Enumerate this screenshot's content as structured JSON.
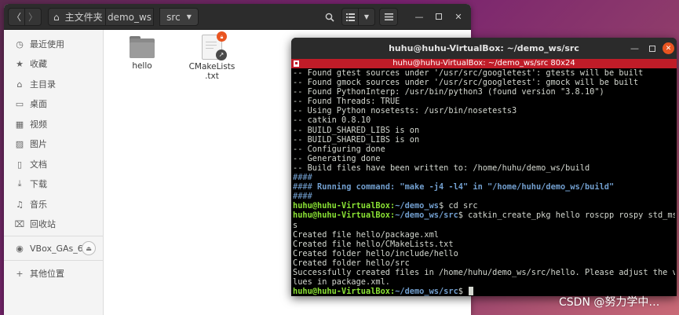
{
  "file_manager": {
    "breadcrumb": {
      "home": "主文件夹",
      "ws": "demo_ws",
      "src": "src"
    },
    "sidebar": [
      {
        "icon": "clock-icon",
        "label": "最近使用"
      },
      {
        "icon": "star-icon",
        "label": "收藏"
      },
      {
        "icon": "home-icon",
        "label": "主目录"
      },
      {
        "icon": "desktop-icon",
        "label": "桌面"
      },
      {
        "icon": "video-icon",
        "label": "视频"
      },
      {
        "icon": "image-icon",
        "label": "图片"
      },
      {
        "icon": "document-icon",
        "label": "文档"
      },
      {
        "icon": "download-icon",
        "label": "下载"
      },
      {
        "icon": "music-icon",
        "label": "音乐"
      },
      {
        "icon": "trash-icon",
        "label": "回收站"
      },
      {
        "icon": "disc-icon",
        "label": "VBox_GAs_6...."
      },
      {
        "icon": "plus-icon",
        "label": "其他位置"
      }
    ],
    "files": [
      {
        "name": "hello",
        "type": "folder"
      },
      {
        "name": "CMakeLists\n.txt",
        "type": "text"
      }
    ]
  },
  "terminal": {
    "title": "huhu@huhu-VirtualBox: ~/demo_ws/src",
    "tab_label": "huhu@huhu-VirtualBox: ~/demo_ws/src 80x24",
    "lines": [
      "-- Found gtest sources under '/usr/src/googletest': gtests will be built",
      "-- Found gmock sources under '/usr/src/googletest': gmock will be built",
      "-- Found PythonInterp: /usr/bin/python3 (found version \"3.8.10\")",
      "-- Found Threads: TRUE",
      "-- Using Python nosetests: /usr/bin/nosetests3",
      "-- catkin 0.8.10",
      "-- BUILD_SHARED_LIBS is on",
      "-- BUILD_SHARED_LIBS is on",
      "-- Configuring done",
      "-- Generating done",
      "-- Build files have been written to: /home/huhu/demo_ws/build",
      "####",
      "#### Running command: \"make -j4 -l4\" in \"/home/huhu/demo_ws/build\"",
      "####",
      "huhu@huhu-VirtualBox:~/demo_ws$ cd src",
      "huhu@huhu-VirtualBox:~/demo_ws/src$ catkin_create_pkg hello roscpp rospy std_msg",
      "s",
      "Created file hello/package.xml",
      "Created file hello/CMakeLists.txt",
      "Created folder hello/include/hello",
      "Created folder hello/src",
      "Successfully created files in /home/huhu/demo_ws/src/hello. Please adjust the va",
      "lues in package.xml.",
      "huhu@huhu-VirtualBox:~/demo_ws/src$ "
    ],
    "colors": {
      "user": "#8ae234",
      "path": "#729fcf",
      "text": "#d3d7cf",
      "tab_bar": "#c01c28"
    }
  },
  "watermark": "CSDN @努力学中…"
}
